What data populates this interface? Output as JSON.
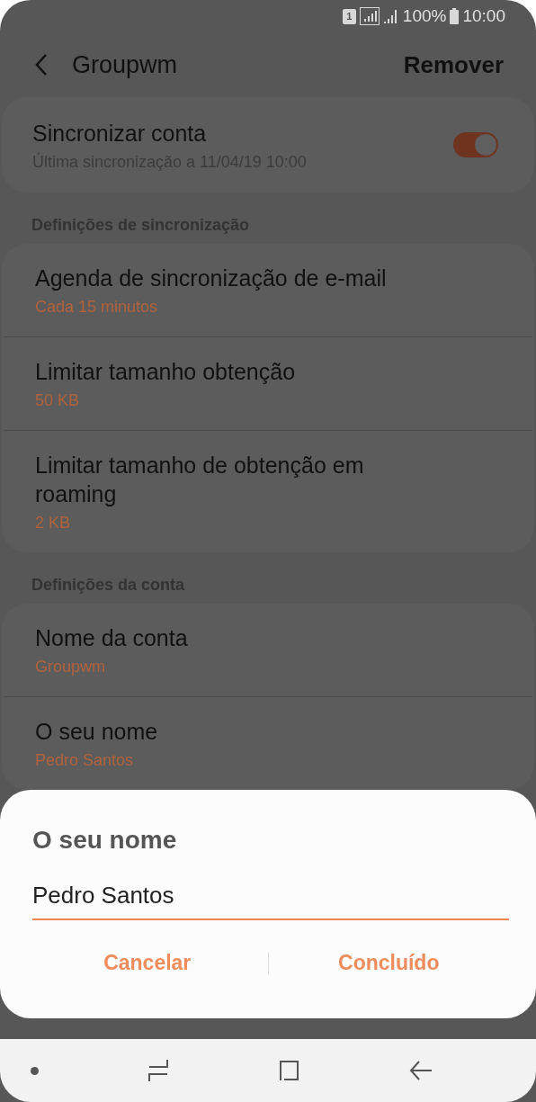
{
  "status_bar": {
    "sim": "1",
    "battery": "100%",
    "time": "10:00"
  },
  "header": {
    "title": "Groupwm",
    "action": "Remover"
  },
  "sync": {
    "title": "Sincronizar conta",
    "subtitle": "Última sincronização a 11/04/19  10:00",
    "on": true
  },
  "sections": [
    {
      "heading": "Definições de sincronização",
      "items": [
        {
          "title": "Agenda de sincronização de e-mail",
          "value": "Cada 15 minutos"
        },
        {
          "title": "Limitar tamanho obtenção",
          "value": "50 KB"
        },
        {
          "title": "Limitar tamanho de obtenção em roaming",
          "value": "2 KB"
        }
      ]
    },
    {
      "heading": "Definições da conta",
      "items": [
        {
          "title": "Nome da conta",
          "value": "Groupwm"
        },
        {
          "title": "O seu nome",
          "value": "Pedro Santos"
        }
      ]
    }
  ],
  "dialog": {
    "title": "O seu nome",
    "value": "Pedro Santos",
    "buttons": [
      "Cancelar",
      "Concluído"
    ]
  }
}
